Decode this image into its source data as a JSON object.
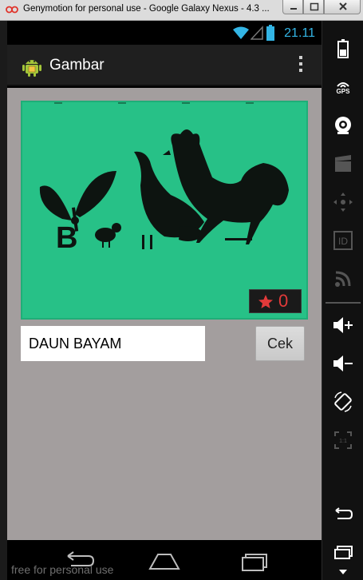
{
  "window": {
    "title": "Genymotion for personal use - Google Galaxy Nexus - 4.3 ...",
    "buttons": [
      "minimize",
      "maximize",
      "close"
    ]
  },
  "statusbar": {
    "time": "21.11",
    "icons": [
      "wifi-icon",
      "signal-icon",
      "battery-icon"
    ],
    "accent": "#33b5e5"
  },
  "actionbar": {
    "title": "Gambar",
    "icon": "android-app-icon",
    "overflow": "overflow-menu-icon"
  },
  "quiz": {
    "picture_letter": "B",
    "stars_count": "0",
    "answer_value": "DAUN BAYAM",
    "submit_label": "Cek"
  },
  "navbar": {
    "buttons": [
      "back-icon",
      "home-icon",
      "recent-apps-icon"
    ],
    "watermark": "free for personal use"
  },
  "sidepanel": {
    "gps_label": "GPS",
    "id_label": "ID",
    "items": [
      "battery-icon",
      "gps-icon",
      "camera-icon",
      "video-icon",
      "dpad-icon",
      "id-icon",
      "rss-icon",
      "volume-up-icon",
      "volume-down-icon",
      "rotate-icon",
      "scale-icon",
      "back-icon",
      "recent-apps-icon",
      "menu-icon"
    ]
  },
  "colors": {
    "content_bg": "#a39e9e",
    "picture_bg": "#27c187",
    "star_color": "#e23a3a",
    "actionbar_bg": "#1f1f1f"
  }
}
